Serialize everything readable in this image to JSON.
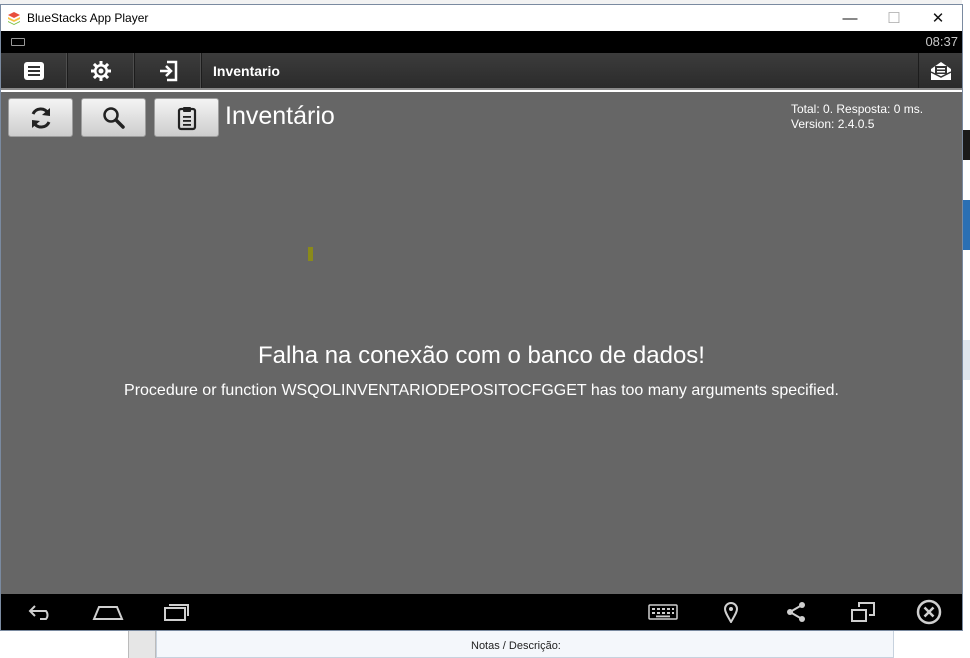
{
  "window": {
    "title": "BlueStacks App Player",
    "minimize_glyph": "—",
    "maximize_glyph": "☐",
    "close_glyph": "✕"
  },
  "statusbar": {
    "time": "08:37"
  },
  "actionbar": {
    "title": "Inventario",
    "icons": [
      "menu-list-icon",
      "gear-icon",
      "sign-in-icon",
      "mail-icon"
    ]
  },
  "toolbar": {
    "buttons": [
      "refresh-icon",
      "search-icon",
      "clipboard-icon"
    ]
  },
  "page": {
    "title": "Inventário",
    "info_line1": "Total: 0. Resposta: 0 ms.",
    "info_line2": "Version: 2.4.0.5"
  },
  "error": {
    "title": "Falha na conexão com o banco de dados!",
    "detail": "Procedure or function WSQOLINVENTARIODEPOSITOCFGGET has too many arguments specified."
  },
  "navbar": {
    "icons": [
      "back-icon",
      "home-icon",
      "recent-apps-icon",
      "keyboard-icon",
      "location-icon",
      "share-icon",
      "screen-rotate-icon",
      "close-app-icon"
    ]
  },
  "background": {
    "notes_label": "Notas / Descrição:"
  },
  "colors": {
    "content_bg": "#666666",
    "actionbar_bg": "#333333",
    "statusbar_bg": "#000000"
  }
}
